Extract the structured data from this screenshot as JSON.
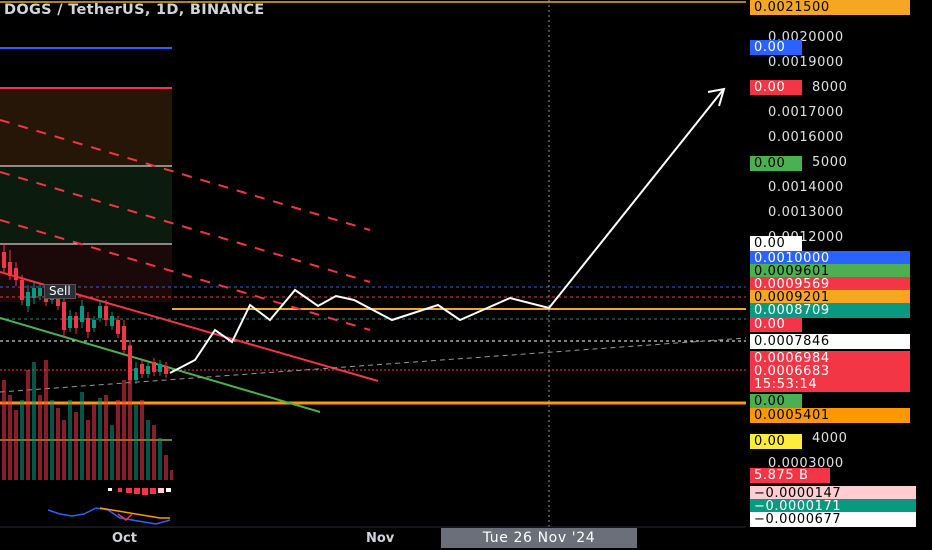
{
  "header": {
    "title": "DOGS / TetherUS, 1D, BINANCE"
  },
  "chart_labels": {
    "sell": "Sell"
  },
  "price_axis": {
    "ticks": [
      "0.0020000",
      "0.0019000",
      "8000",
      "0.0017000",
      "0.0016000",
      "5000",
      "0.0014000",
      "0.0013000",
      "0.0012000",
      "4000",
      "0.0003000"
    ]
  },
  "badges": [
    {
      "text": "0.0021500",
      "bg": "#f6a623",
      "fg": "#000000"
    },
    {
      "text": "0.00",
      "bg": "#2962ff",
      "fg": "#ffffff"
    },
    {
      "text": "0.00",
      "bg": "#f23645",
      "fg": "#ffffff"
    },
    {
      "text": "0.00",
      "bg": "#4caf50",
      "fg": "#000000"
    },
    {
      "text": "0.00",
      "bg": "#ffffff",
      "fg": "#000000"
    },
    {
      "text": "0.0010000",
      "bg": "#2962ff",
      "fg": "#ffffff"
    },
    {
      "text": "0.0009601",
      "bg": "#4caf50",
      "fg": "#000000"
    },
    {
      "text": "0.0009569",
      "bg": "#f23645",
      "fg": "#ffffff"
    },
    {
      "text": "0.0009201",
      "bg": "#f6a623",
      "fg": "#000000"
    },
    {
      "text": "0.0008709",
      "bg": "#089981",
      "fg": "#ffffff"
    },
    {
      "text": "0.00",
      "bg": "#f23645",
      "fg": "#ffffff"
    },
    {
      "text": "0.0007846",
      "bg": "#ffffff",
      "fg": "#000000"
    },
    {
      "text": "0.0006984",
      "bg": "#f23645",
      "fg": "#ffffff"
    },
    {
      "text": "0.0006683",
      "bg": "#f23645",
      "fg": "#ffffff"
    },
    {
      "text": "15:53:14",
      "bg": "#f23645",
      "fg": "#ffffff"
    },
    {
      "text": "0.00",
      "bg": "#4caf50",
      "fg": "#000000"
    },
    {
      "text": "0.0005401",
      "bg": "#ff9800",
      "fg": "#000000"
    },
    {
      "text": "0.00",
      "bg": "#ffeb3b",
      "fg": "#000000"
    },
    {
      "text": "5.875 B",
      "bg": "#f23645",
      "fg": "#ffffff"
    },
    {
      "text": "−0.0000147",
      "bg": "#ffcdd2",
      "fg": "#000000"
    },
    {
      "text": "−0.0000171",
      "bg": "#089981",
      "fg": "#ffffff"
    },
    {
      "text": "−0.0000677",
      "bg": "#ffffff",
      "fg": "#000000"
    }
  ],
  "time_axis": {
    "oct": "Oct",
    "nov": "Nov",
    "cursor": "Tue 26 Nov '24"
  },
  "colors": {
    "background": "#000000",
    "bullish": "#089981",
    "bearish": "#f23645",
    "forecast": "#ffffff"
  }
}
